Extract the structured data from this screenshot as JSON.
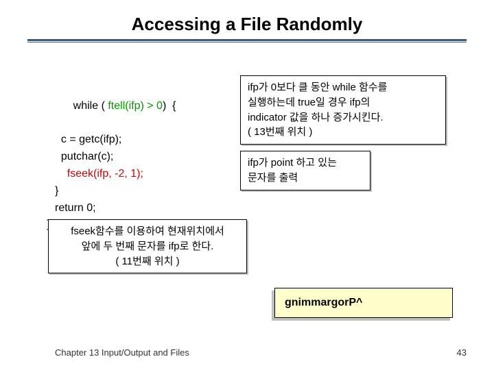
{
  "title": "Accessing a File Randomly",
  "code": {
    "l1": "while ( ",
    "l1b": "ftell(ifp) > 0",
    "l1c": ")  {",
    "l2": "  c = getc(ifp);",
    "l3": "  putchar(c);",
    "l4": "  fseek(ifp, -2, 1);",
    "l5": "}",
    "l6": "return 0;",
    "l7": "}"
  },
  "anno1": {
    "t1": "ifp가 0보다 클 동안 while 함수를",
    "t2": "실행하는데 true일 경우 ifp의",
    "t3": "indicator 값을 하나 증가시킨다.",
    "t4": "( 13번째 위치 )"
  },
  "anno2": {
    "t1": "ifp가 point 하고 있는",
    "t2": "문자를 출력"
  },
  "anno3": {
    "t1": "fseek함수를 이용하여 현재위치에서",
    "t2": "앞에 두 번째 문자를 ifp로 한다.",
    "t3": "( 11번째 위치 )"
  },
  "output": "gnimmargorP^",
  "footer": "Chapter 13  Input/Output and Files",
  "page": "43"
}
